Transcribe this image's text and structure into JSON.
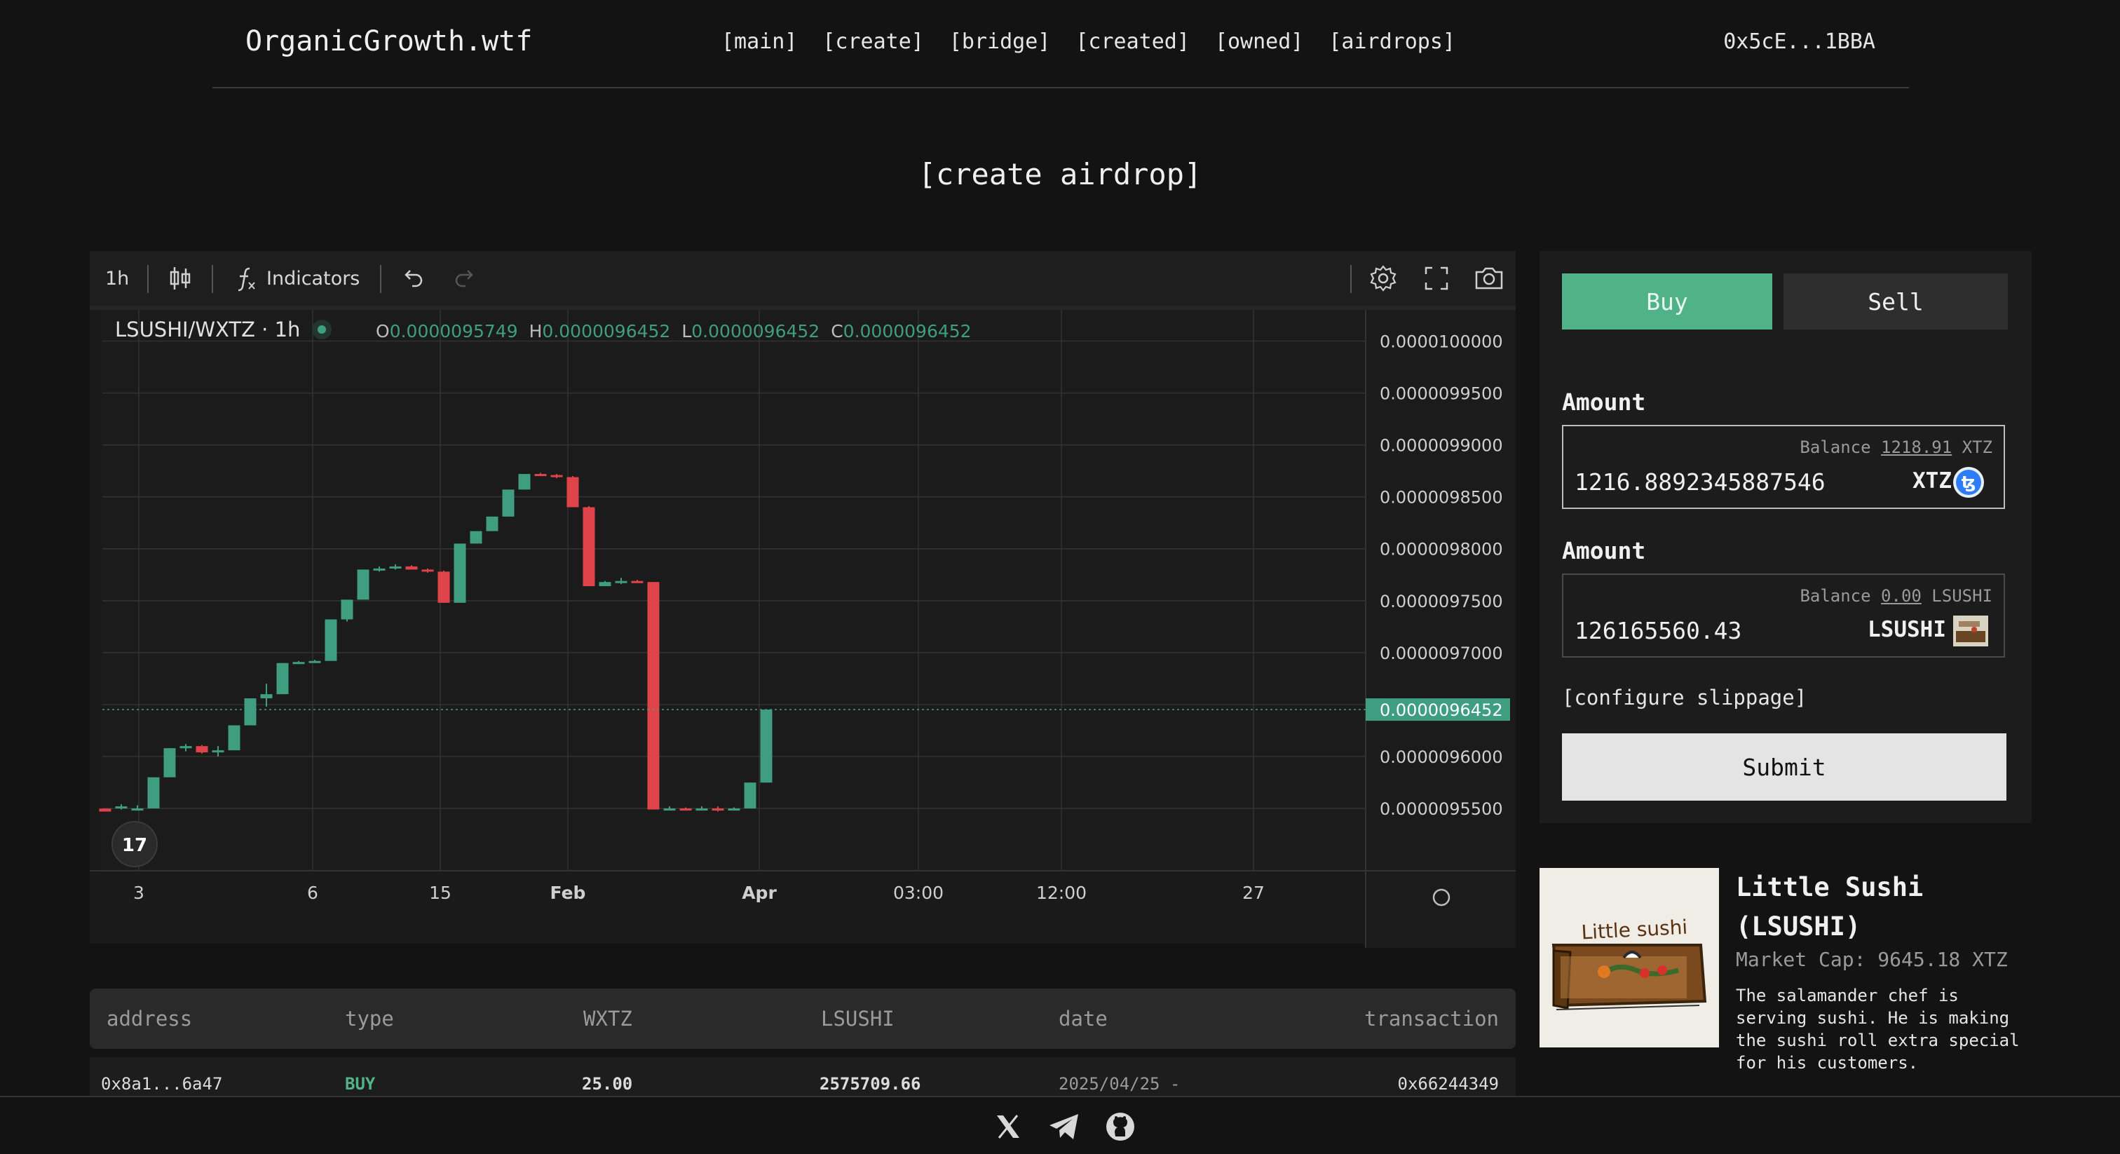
{
  "header": {
    "logo": "OrganicGrowth.wtf",
    "nav": [
      "[main]",
      "[create]",
      "[bridge]",
      "[created]",
      "[owned]",
      "[airdrops]"
    ],
    "wallet": "0x5cE...1BBA"
  },
  "page_title": "[create airdrop]",
  "chart": {
    "toolbar": {
      "interval": "1h",
      "indicators": "Indicators"
    },
    "symbol": "LSUSHI/WXTZ · 1h",
    "ohlc": {
      "o_label": "O",
      "o": "0.0000095749",
      "h_label": "H",
      "h": "0.0000096452",
      "l_label": "L",
      "l": "0.0000096452",
      "c_label": "C",
      "c": "0.0000096452"
    },
    "colors": {
      "up": "#3f9e7f",
      "down": "#e0434a",
      "grid": "#333333"
    }
  },
  "chart_data": {
    "type": "candlestick",
    "y_ticks": [
      "0.0000100000",
      "0.0000099500",
      "0.0000099000",
      "0.0000098500",
      "0.0000098000",
      "0.0000097500",
      "0.0000097000",
      "0.0000096500",
      "0.0000096000",
      "0.0000095500"
    ],
    "ylim": [
      9.49e-06,
      1.003e-05
    ],
    "x_ticks": [
      "3",
      "6",
      "15",
      "Feb",
      "Apr",
      "03:00",
      "12:00",
      "27"
    ],
    "last_price": "0.0000096452",
    "candles": [
      {
        "o": 9.5499,
        "h": 9.5499,
        "l": 9.547,
        "c": 9.547
      },
      {
        "o": 9.55,
        "h": 9.554,
        "l": 9.549,
        "c": 9.552
      },
      {
        "o": 9.55,
        "h": 9.553,
        "l": 9.548,
        "c": 9.55
      },
      {
        "o": 9.55,
        "h": 9.58,
        "l": 9.55,
        "c": 9.58
      },
      {
        "o": 9.58,
        "h": 9.608,
        "l": 9.58,
        "c": 9.608
      },
      {
        "o": 9.608,
        "h": 9.612,
        "l": 9.605,
        "c": 9.61
      },
      {
        "o": 9.61,
        "h": 9.611,
        "l": 9.603,
        "c": 9.604
      },
      {
        "o": 9.604,
        "h": 9.61,
        "l": 9.6,
        "c": 9.606
      },
      {
        "o": 9.606,
        "h": 9.63,
        "l": 9.606,
        "c": 9.63
      },
      {
        "o": 9.63,
        "h": 9.656,
        "l": 9.63,
        "c": 9.656
      },
      {
        "o": 9.656,
        "h": 9.67,
        "l": 9.648,
        "c": 9.66
      },
      {
        "o": 9.66,
        "h": 9.69,
        "l": 9.66,
        "c": 9.69
      },
      {
        "o": 9.69,
        "h": 9.692,
        "l": 9.689,
        "c": 9.691
      },
      {
        "o": 9.691,
        "h": 9.693,
        "l": 9.69,
        "c": 9.692
      },
      {
        "o": 9.692,
        "h": 9.732,
        "l": 9.692,
        "c": 9.732
      },
      {
        "o": 9.732,
        "h": 9.751,
        "l": 9.73,
        "c": 9.751
      },
      {
        "o": 9.751,
        "h": 9.78,
        "l": 9.751,
        "c": 9.78
      },
      {
        "o": 9.78,
        "h": 9.783,
        "l": 9.778,
        "c": 9.781
      },
      {
        "o": 9.781,
        "h": 9.785,
        "l": 9.78,
        "c": 9.783
      },
      {
        "o": 9.783,
        "h": 9.784,
        "l": 9.78,
        "c": 9.78
      },
      {
        "o": 9.78,
        "h": 9.781,
        "l": 9.777,
        "c": 9.778
      },
      {
        "o": 9.778,
        "h": 9.779,
        "l": 9.748,
        "c": 9.748
      },
      {
        "o": 9.748,
        "h": 9.805,
        "l": 9.748,
        "c": 9.805
      },
      {
        "o": 9.805,
        "h": 9.817,
        "l": 9.805,
        "c": 9.817
      },
      {
        "o": 9.817,
        "h": 9.831,
        "l": 9.817,
        "c": 9.831
      },
      {
        "o": 9.831,
        "h": 9.857,
        "l": 9.831,
        "c": 9.857
      },
      {
        "o": 9.857,
        "h": 9.872,
        "l": 9.857,
        "c": 9.872
      },
      {
        "o": 9.872,
        "h": 9.873,
        "l": 9.87,
        "c": 9.871
      },
      {
        "o": 9.871,
        "h": 9.872,
        "l": 9.868,
        "c": 9.869
      },
      {
        "o": 9.869,
        "h": 9.87,
        "l": 9.84,
        "c": 9.84
      },
      {
        "o": 9.84,
        "h": 9.841,
        "l": 9.764,
        "c": 9.764
      },
      {
        "o": 9.764,
        "h": 9.769,
        "l": 9.764,
        "c": 9.768
      },
      {
        "o": 9.768,
        "h": 9.772,
        "l": 9.766,
        "c": 9.769
      },
      {
        "o": 9.769,
        "h": 9.77,
        "l": 9.767,
        "c": 9.768
      },
      {
        "o": 9.768,
        "h": 9.768,
        "l": 9.549,
        "c": 9.549
      },
      {
        "o": 9.549,
        "h": 9.552,
        "l": 9.548,
        "c": 9.55
      },
      {
        "o": 9.55,
        "h": 9.551,
        "l": 9.548,
        "c": 9.549
      },
      {
        "o": 9.549,
        "h": 9.552,
        "l": 9.548,
        "c": 9.55
      },
      {
        "o": 9.55,
        "h": 9.552,
        "l": 9.547,
        "c": 9.549
      },
      {
        "o": 9.549,
        "h": 9.551,
        "l": 9.548,
        "c": 9.55
      },
      {
        "o": 9.55,
        "h": 9.575,
        "l": 9.55,
        "c": 9.5749
      },
      {
        "o": 9.5749,
        "h": 9.6452,
        "l": 9.5749,
        "c": 9.6452
      }
    ]
  },
  "trade": {
    "buy": "Buy",
    "sell": "Sell",
    "amount_label_1": "Amount",
    "balance_label": "Balance",
    "balance_xtz": "1218.91",
    "xtz_unit": "XTZ",
    "amount_xtz": "1216.8892345887546",
    "amount_label_2": "Amount",
    "balance_lsushi": "0.00",
    "lsushi_unit": "LSUSHI",
    "amount_lsushi": "126165560.43",
    "slippage": "[configure slippage]",
    "submit": "Submit"
  },
  "token": {
    "name": "Little Sushi (LSUSHI)",
    "market_cap": "Market Cap: 9645.18 XTZ",
    "description": "The salamander chef is serving sushi. He is making the sushi roll extra special for his customers.",
    "image_text": "Little sushi"
  },
  "table": {
    "headers": [
      "address",
      "type",
      "WXTZ",
      "LSUSHI",
      "date",
      "transaction"
    ],
    "rows": [
      {
        "address": "0x8a1...6a47",
        "type": "BUY",
        "wxtz": "25.00",
        "lsushi": "2575709.66",
        "date": "2025/04/25 -",
        "transaction": "0x66244349"
      }
    ]
  },
  "footer": {
    "icons": [
      "x-icon",
      "telegram-icon",
      "github-icon"
    ]
  }
}
